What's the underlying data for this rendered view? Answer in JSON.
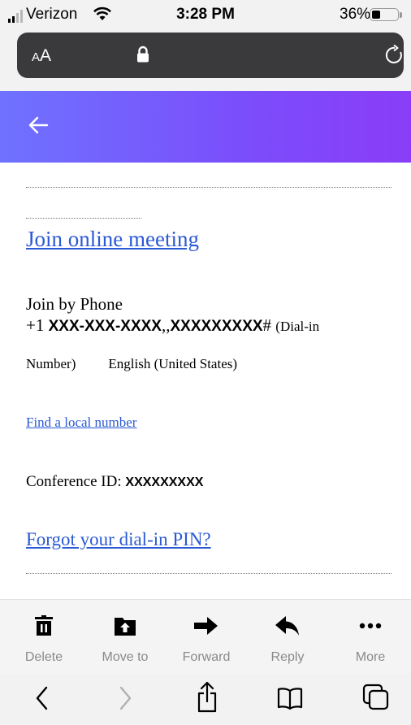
{
  "status_bar": {
    "carrier": "Verizon",
    "time": "3:28 PM",
    "battery_percent": "36%",
    "battery_level": 0.36,
    "signal_bars": 2
  },
  "address_bar": {
    "text_size_label": "AA",
    "lock_icon": "lock-icon",
    "reload_icon": "reload-icon"
  },
  "header": {
    "back_icon": "back-arrow-icon",
    "gradient": [
      "#6f72ff",
      "#8a3df7"
    ]
  },
  "message": {
    "join_link": "Join online meeting",
    "join_by_phone": "Join by Phone",
    "phone_prefix": "+1 ",
    "phone_number": "XXX-XXX-XXXX",
    "phone_separator": ",,",
    "phone_extension": "XXXXXXXXX",
    "phone_hash": "#",
    "dial_in_open": "(Dial-in",
    "dial_in_number": "Number)",
    "language": "English (United States)",
    "find_local": "Find a local number",
    "conference_label": "Conference ID: ",
    "conference_id": "XXXXXXXXX",
    "forgot_pin": "Forgot your dial-in PIN?"
  },
  "toolbar": {
    "items": [
      {
        "label": "Delete",
        "icon": "trash-icon"
      },
      {
        "label": "Move to",
        "icon": "folder-move-icon"
      },
      {
        "label": "Forward",
        "icon": "forward-arrow-icon"
      },
      {
        "label": "Reply",
        "icon": "reply-arrow-icon"
      },
      {
        "label": "More",
        "icon": "more-dots-icon"
      }
    ]
  },
  "browser_toolbar": {
    "icons": [
      "back-icon",
      "forward-icon",
      "share-icon",
      "bookmarks-icon",
      "tabs-icon"
    ]
  },
  "colors": {
    "link": "#2a59d4",
    "toolbar_label": "#8a8a8a"
  }
}
